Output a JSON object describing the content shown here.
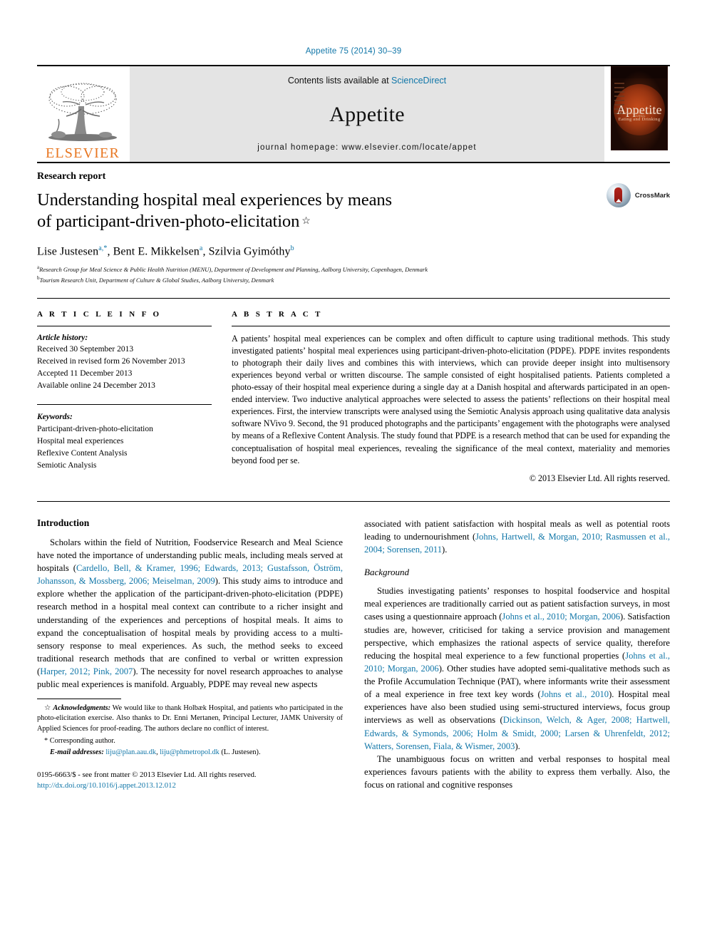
{
  "running_head": "Appetite 75 (2014) 30–39",
  "masthead": {
    "publisher_name": "ELSEVIER",
    "contents_prefix": "Contents lists available at ",
    "contents_link": "ScienceDirect",
    "journal_title": "Appetite",
    "homepage": "journal homepage: www.elsevier.com/locate/appet",
    "cover": {
      "title": "Appetite",
      "micro": "AN INTERNATIONAL RESEARCH JOURNAL",
      "subtitle": "Eating and Drinking"
    }
  },
  "article": {
    "section_type": "Research report",
    "title_line1": "Understanding hospital meal experiences by means",
    "title_line2": "of participant-driven-photo-elicitation",
    "title_star": "☆",
    "crossmark_label": "CrossMark",
    "authors": [
      {
        "name": "Lise Justesen",
        "sup": "a,*"
      },
      {
        "name": "Bent E. Mikkelsen",
        "sup": "a"
      },
      {
        "name": "Szilvia Gyimóthy",
        "sup": "b"
      }
    ],
    "affiliations": [
      {
        "marker": "a",
        "text": "Research Group for Meal Science & Public Health Nutrition (MENU), Department of Development and Planning, Aalborg University, Copenhagen, Denmark"
      },
      {
        "marker": "b",
        "text": "Tourism Research Unit, Department of Culture & Global Studies, Aalborg University, Denmark"
      }
    ]
  },
  "info": {
    "heading": "A R T I C L E   I N F O",
    "history_label": "Article history:",
    "history": [
      "Received 30 September 2013",
      "Received in revised form 26 November 2013",
      "Accepted 11 December 2013",
      "Available online 24 December 2013"
    ],
    "keywords_label": "Keywords:",
    "keywords": [
      "Participant-driven-photo-elicitation",
      "Hospital meal experiences",
      "Reflexive Content Analysis",
      "Semiotic Analysis"
    ]
  },
  "abstract": {
    "heading": "A B S T R A C T",
    "text": "A patients’ hospital meal experiences can be complex and often difficult to capture using traditional methods. This study investigated patients’ hospital meal experiences using participant-driven-photo-elicitation (PDPE). PDPE invites respondents to photograph their daily lives and combines this with interviews, which can provide deeper insight into multisensory experiences beyond verbal or written discourse. The sample consisted of eight hospitalised patients. Patients completed a photo-essay of their hospital meal experience during a single day at a Danish hospital and afterwards participated in an open-ended interview. Two inductive analytical approaches were selected to assess the patients’ reflections on their hospital meal experiences. First, the interview transcripts were analysed using the Semiotic Analysis approach using qualitative data analysis software NVivo 9. Second, the 91 produced photographs and the participants’ engagement with the photographs were analysed by means of a Reflexive Content Analysis. The study found that PDPE is a research method that can be used for expanding the conceptualisation of hospital meal experiences, revealing the significance of the meal context, materiality and memories beyond food per se.",
    "copyright": "© 2013 Elsevier Ltd. All rights reserved."
  },
  "body": {
    "left": {
      "section_heading": "Introduction",
      "para1_a": "Scholars within the field of Nutrition, Foodservice Research and Meal Science have noted the importance of understanding public meals, including meals served at hospitals (",
      "para1_cite1": "Cardello, Bell, & Kramer, 1996; Edwards, 2013; Gustafsson, Öström, Johansson, & Mossberg, 2006; Meiselman, 2009",
      "para1_b": "). This study aims to introduce and explore whether the application of the participant-driven-photo-elicitation (PDPE) research method in a hospital meal context can contribute to a richer insight and understanding of the experiences and perceptions of hospital meals. It aims to expand the conceptualisation of hospital meals by providing access to a multi-sensory response to meal experiences. As such, the method seeks to exceed traditional research methods that are confined to verbal or written expression (",
      "para1_cite2": "Harper, 2012; Pink, 2007",
      "para1_c": "). The necessity for novel research approaches to analyse public meal experiences is manifold. Arguably, PDPE may reveal new aspects"
    },
    "right": {
      "para_top_a": "associated with patient satisfaction with hospital meals as well as potential roots leading to undernourishment (",
      "para_top_cite": "Johns, Hartwell, & Morgan, 2010; Rasmussen et al., 2004; Sorensen, 2011",
      "para_top_b": ").",
      "subsection_heading": "Background",
      "para2_a": "Studies investigating patients’ responses to hospital foodservice and hospital meal experiences are traditionally carried out as patient satisfaction surveys, in most cases using a questionnaire approach (",
      "para2_cite1": "Johns et al., 2010; Morgan, 2006",
      "para2_b": "). Satisfaction studies are, however, criticised for taking a service provision and management perspective, which emphasizes the rational aspects of service quality, therefore reducing the hospital meal experience to a few functional properties (",
      "para2_cite2": "Johns et al., 2010; Morgan, 2006",
      "para2_c": "). Other studies have adopted semi-qualitative methods such as the Profile Accumulation Technique (PAT), where informants write their assessment of a meal experience in free text key words (",
      "para2_cite3": "Johns et al., 2010",
      "para2_d": "). Hospital meal experiences have also been studied using semi-structured interviews, focus group interviews as well as observations (",
      "para2_cite4": "Dickinson, Welch, & Ager, 2008; Hartwell, Edwards, & Symonds, 2006; Holm & Smidt, 2000; Larsen & Uhrenfeldt, 2012; Watters, Sorensen, Fiala, & Wismer, 2003",
      "para2_e": ").",
      "para3": "The unambiguous focus on written and verbal responses to hospital meal experiences favours patients with the ability to express them verbally. Also, the focus on rational and cognitive responses"
    }
  },
  "footnotes": {
    "ack_marker": "☆",
    "ack_label": "Acknowledgments:",
    "ack_text": " We would like to thank Holbæk Hospital, and patients who participated in the photo-elicitation exercise. Also thanks to Dr. Enni Mertanen, Principal Lecturer, JAMK University of Applied Sciences for proof-reading. The authors declare no conflict of interest.",
    "corresponding": "* Corresponding author.",
    "email_label": "E-mail addresses:",
    "email1": "liju@plan.aau.dk",
    "email_sep": ", ",
    "email2": "liju@phmetropol.dk",
    "email_suffix": " (L. Justesen).",
    "issn_line": "0195-6663/$ - see front matter © 2013 Elsevier Ltd. All rights reserved.",
    "doi_line": "http://dx.doi.org/10.1016/j.appet.2013.12.012"
  },
  "colors": {
    "link": "#1076a8",
    "elsevier_orange": "#E87722",
    "masthead_grey": "#e4e4e4"
  }
}
